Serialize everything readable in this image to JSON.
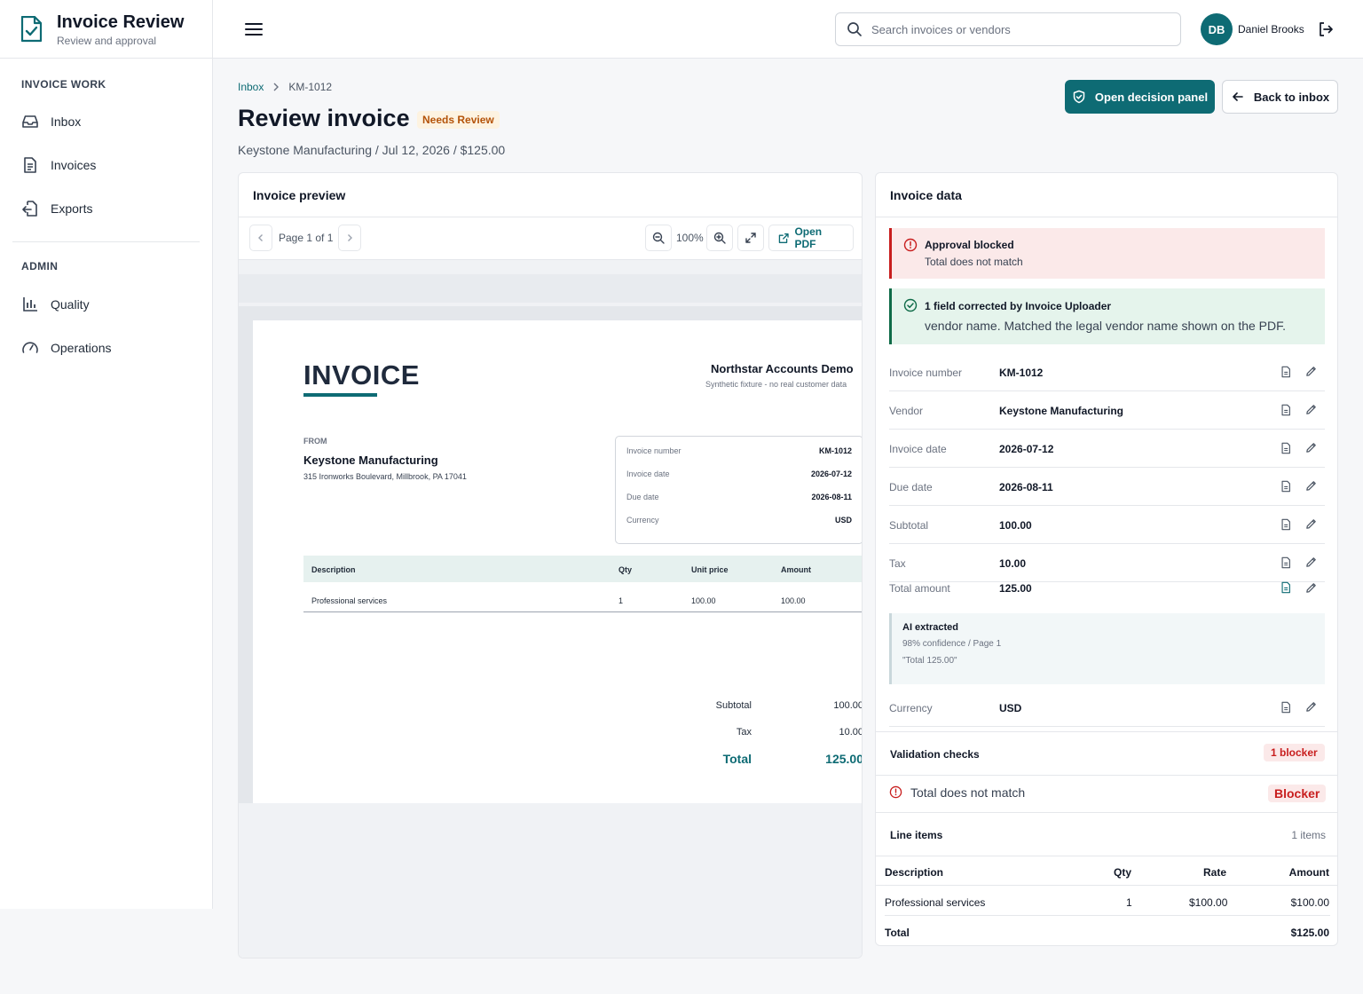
{
  "app": {
    "title": "Invoice Review",
    "subtitle": "Review and approval"
  },
  "sidebar": {
    "sections": [
      {
        "label": "INVOICE WORK",
        "items": [
          {
            "label": "Inbox",
            "icon": "inbox-icon"
          },
          {
            "label": "Invoices",
            "icon": "document-icon"
          },
          {
            "label": "Exports",
            "icon": "export-icon"
          }
        ]
      },
      {
        "label": "ADMIN",
        "items": [
          {
            "label": "Quality",
            "icon": "bar-chart-icon"
          },
          {
            "label": "Operations",
            "icon": "gauge-icon"
          }
        ]
      }
    ]
  },
  "topbar": {
    "search_placeholder": "Search invoices or vendors",
    "user": {
      "initials": "DB",
      "name": "Daniel Brooks"
    }
  },
  "header": {
    "breadcrumb": {
      "root": "Inbox",
      "current": "KM-1012"
    },
    "title": "Review invoice",
    "status": "Needs Review",
    "subtitle": "Keystone Manufacturing / Jul 12, 2026 / $125.00",
    "primary_action": "Open decision panel",
    "secondary_action": "Back to inbox"
  },
  "preview": {
    "title": "Invoice preview",
    "page_label": "Page 1 of 1",
    "zoom": "100%",
    "open_pdf": "Open PDF",
    "document": {
      "heading": "INVOICE",
      "company": "Northstar Accounts Demo",
      "fixture_note": "Synthetic fixture - no real customer data",
      "from_label": "FROM",
      "vendor": "Keystone Manufacturing",
      "address": "315 Ironworks Boulevard, Millbrook, PA 17041",
      "meta": [
        {
          "k": "Invoice number",
          "v": "KM-1012"
        },
        {
          "k": "Invoice date",
          "v": "2026-07-12"
        },
        {
          "k": "Due date",
          "v": "2026-08-11"
        },
        {
          "k": "Currency",
          "v": "USD"
        }
      ],
      "table_headers": {
        "description": "Description",
        "qty": "Qty",
        "unit_price": "Unit price",
        "amount": "Amount"
      },
      "row": {
        "description": "Professional services",
        "qty": "1",
        "unit_price": "100.00",
        "amount": "100.00"
      },
      "totals": {
        "subtotal_label": "Subtotal",
        "subtotal": "100.00",
        "tax_label": "Tax",
        "tax": "10.00",
        "total_label": "Total",
        "total": "125.00"
      }
    }
  },
  "data_panel": {
    "title": "Invoice data",
    "alert_blocked": {
      "title": "Approval blocked",
      "body": "Total does not match"
    },
    "alert_corrected": {
      "title": "1 field corrected by Invoice Uploader",
      "body": "vendor name. Matched the legal vendor name shown on the PDF."
    },
    "fields": [
      {
        "label": "Invoice number",
        "value": "KM-1012"
      },
      {
        "label": "Vendor",
        "value": "Keystone Manufacturing"
      },
      {
        "label": "Invoice date",
        "value": "2026-07-12"
      },
      {
        "label": "Due date",
        "value": "2026-08-11"
      },
      {
        "label": "Subtotal",
        "value": "100.00"
      },
      {
        "label": "Tax",
        "value": "10.00"
      },
      {
        "label": "Total amount",
        "value": "125.00"
      },
      {
        "label": "Currency",
        "value": "USD"
      }
    ],
    "ai": {
      "title": "AI extracted",
      "confidence": "98% confidence / Page 1",
      "quote": "\"Total 125.00\""
    },
    "validation": {
      "title": "Validation checks",
      "count": "1 blocker",
      "item": "Total does not match",
      "item_badge": "Blocker"
    },
    "line_items": {
      "title": "Line items",
      "count": "1 items",
      "headers": {
        "description": "Description",
        "qty": "Qty",
        "rate": "Rate",
        "amount": "Amount"
      },
      "row": {
        "description": "Professional services",
        "qty": "1",
        "rate": "$100.00",
        "amount": "$100.00"
      },
      "total_label": "Total",
      "total": "$125.00"
    }
  },
  "colors": {
    "accent": "#0e6b74",
    "danger": "#c81e1e",
    "success": "#0f6b48",
    "warning": "#b45309"
  }
}
